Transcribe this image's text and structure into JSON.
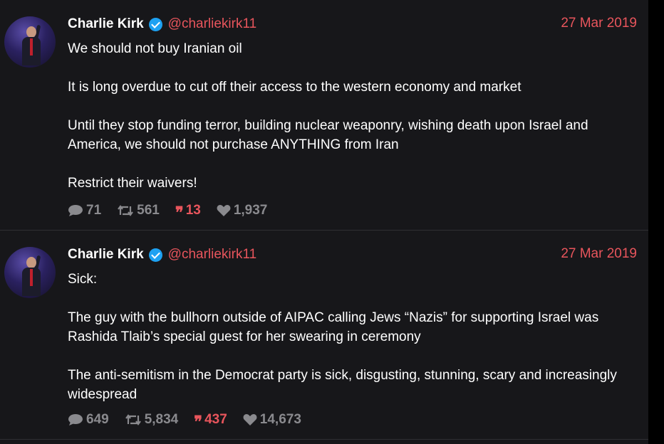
{
  "tweets": [
    {
      "author": "Charlie Kirk",
      "handle": "@charliekirk11",
      "date": "27 Mar 2019",
      "paragraphs": [
        "We should not buy Iranian oil",
        "It is long overdue to cut off their access to the western economy and market",
        "Until they stop funding terror, building nuclear weaponry, wishing death upon Israel and America, we should not purchase ANYTHING from Iran",
        "Restrict their waivers!"
      ],
      "stats": {
        "replies": "71",
        "retweets": "561",
        "quotes": "13",
        "likes": "1,937"
      }
    },
    {
      "author": "Charlie Kirk",
      "handle": "@charliekirk11",
      "date": "27 Mar 2019",
      "paragraphs": [
        "Sick:",
        "The guy with the bullhorn outside of AIPAC calling Jews “Nazis” for supporting Israel was Rashida Tlaib’s special guest for her swearing in ceremony",
        "The anti-semitism in the Democrat party is sick, disgusting, stunning, scary and increasingly widespread"
      ],
      "stats": {
        "replies": "649",
        "retweets": "5,834",
        "quotes": "437",
        "likes": "14,673"
      }
    }
  ],
  "colors": {
    "background": "#17171a",
    "accent": "#e8555c",
    "muted": "#8a8a8e",
    "verified": "#1da1f2"
  },
  "icons": {
    "reply": "comment-bubble-icon",
    "retweet": "retweet-icon",
    "quote": "quote-icon",
    "like": "heart-icon",
    "verified": "verified-badge-icon"
  }
}
